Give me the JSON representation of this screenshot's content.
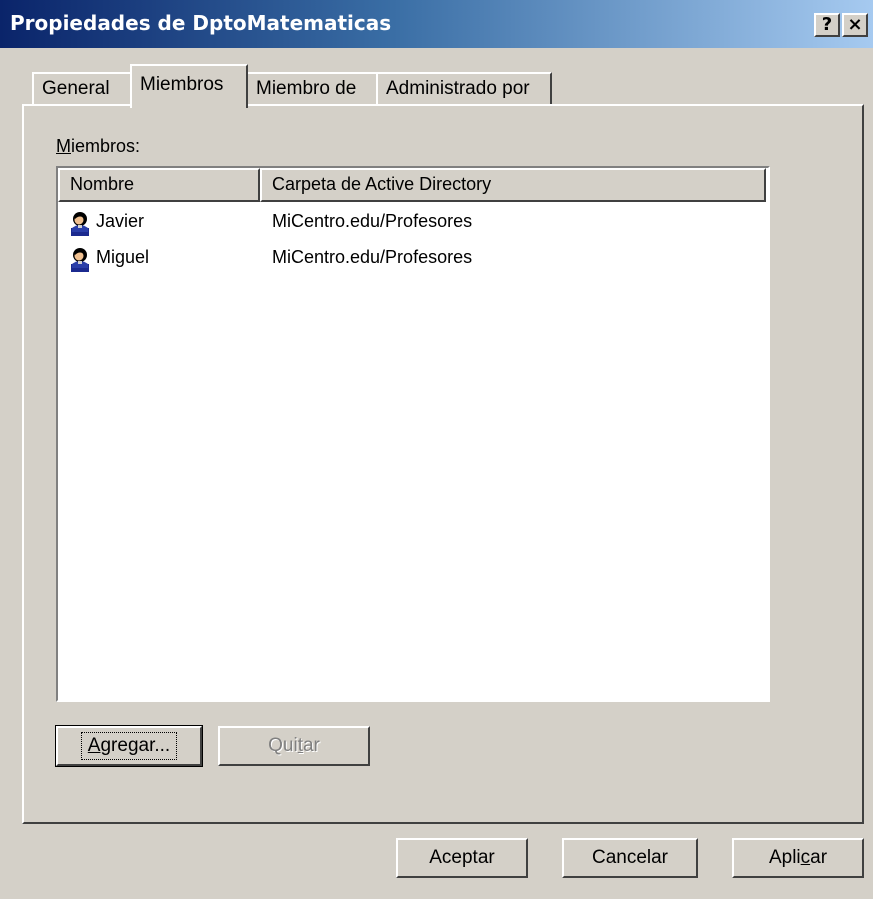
{
  "window": {
    "title": "Propiedades de DptoMatematicas",
    "help_label": "?",
    "close_label": "×"
  },
  "tabs": [
    {
      "label": "General",
      "active": false
    },
    {
      "label": "Miembros",
      "active": true
    },
    {
      "label": "Miembro de",
      "active": false
    },
    {
      "label": "Administrado por",
      "active": false
    }
  ],
  "members": {
    "label_mnemonic": "M",
    "label_rest": "iembros:",
    "columns": [
      "Nombre",
      "Carpeta de Active Directory"
    ],
    "rows": [
      {
        "name": "Javier",
        "folder": "MiCentro.edu/Profesores",
        "icon": "user-icon"
      },
      {
        "name": "Miguel",
        "folder": "MiCentro.edu/Profesores",
        "icon": "user-icon"
      }
    ],
    "add_mnemonic": "A",
    "add_rest": "gregar...",
    "remove_pre": "Qui",
    "remove_mnemonic": "t",
    "remove_post": "ar",
    "remove_enabled": false
  },
  "footer": {
    "ok_label": "Aceptar",
    "cancel_label": "Cancelar",
    "apply_pre": "Apli",
    "apply_mnemonic": "c",
    "apply_post": "ar"
  },
  "colors": {
    "title_start": "#0a246a",
    "title_end": "#a6caf0",
    "face": "#d4d0c8"
  }
}
